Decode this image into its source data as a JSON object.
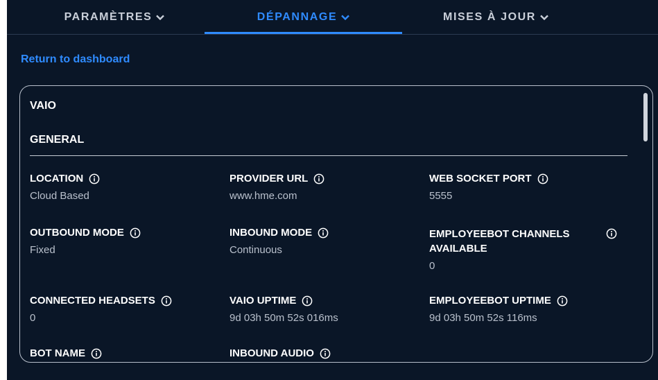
{
  "nav": {
    "tabs": [
      {
        "label": "PARAMÈTRES"
      },
      {
        "label": "DÉPANNAGE"
      },
      {
        "label": "MISES À JOUR"
      }
    ],
    "active_tab": "DÉPANNAGE"
  },
  "return_link": "Return to dashboard",
  "panel": {
    "device_title": "VAIO",
    "section_title": "GENERAL",
    "fields": [
      {
        "label": "LOCATION",
        "value": "Cloud Based"
      },
      {
        "label": "PROVIDER URL",
        "value": "www.hme.com"
      },
      {
        "label": "WEB SOCKET PORT",
        "value": "5555"
      },
      {
        "label": "OUTBOUND MODE",
        "value": "Fixed"
      },
      {
        "label": "INBOUND MODE",
        "value": "Continuous"
      },
      {
        "label": "EMPLOYEEBOT CHANNELS AVAILABLE",
        "value": "0"
      },
      {
        "label": "CONNECTED HEADSETS",
        "value": "0"
      },
      {
        "label": "VAIO UPTIME",
        "value": "9d 03h 50m 52s 016ms"
      },
      {
        "label": "EMPLOYEEBOT UPTIME",
        "value": "9d 03h 50m 52s 116ms"
      },
      {
        "label": "BOT NAME",
        "value": ""
      },
      {
        "label": "INBOUND AUDIO",
        "value": ""
      }
    ]
  },
  "colors": {
    "background": "#0a1627",
    "accent": "#2f8bff",
    "label": "#ffffff",
    "value": "#b9c0cc"
  },
  "icons": {
    "tab_chevron": "chevron-down-icon",
    "field_info": "info-icon"
  }
}
